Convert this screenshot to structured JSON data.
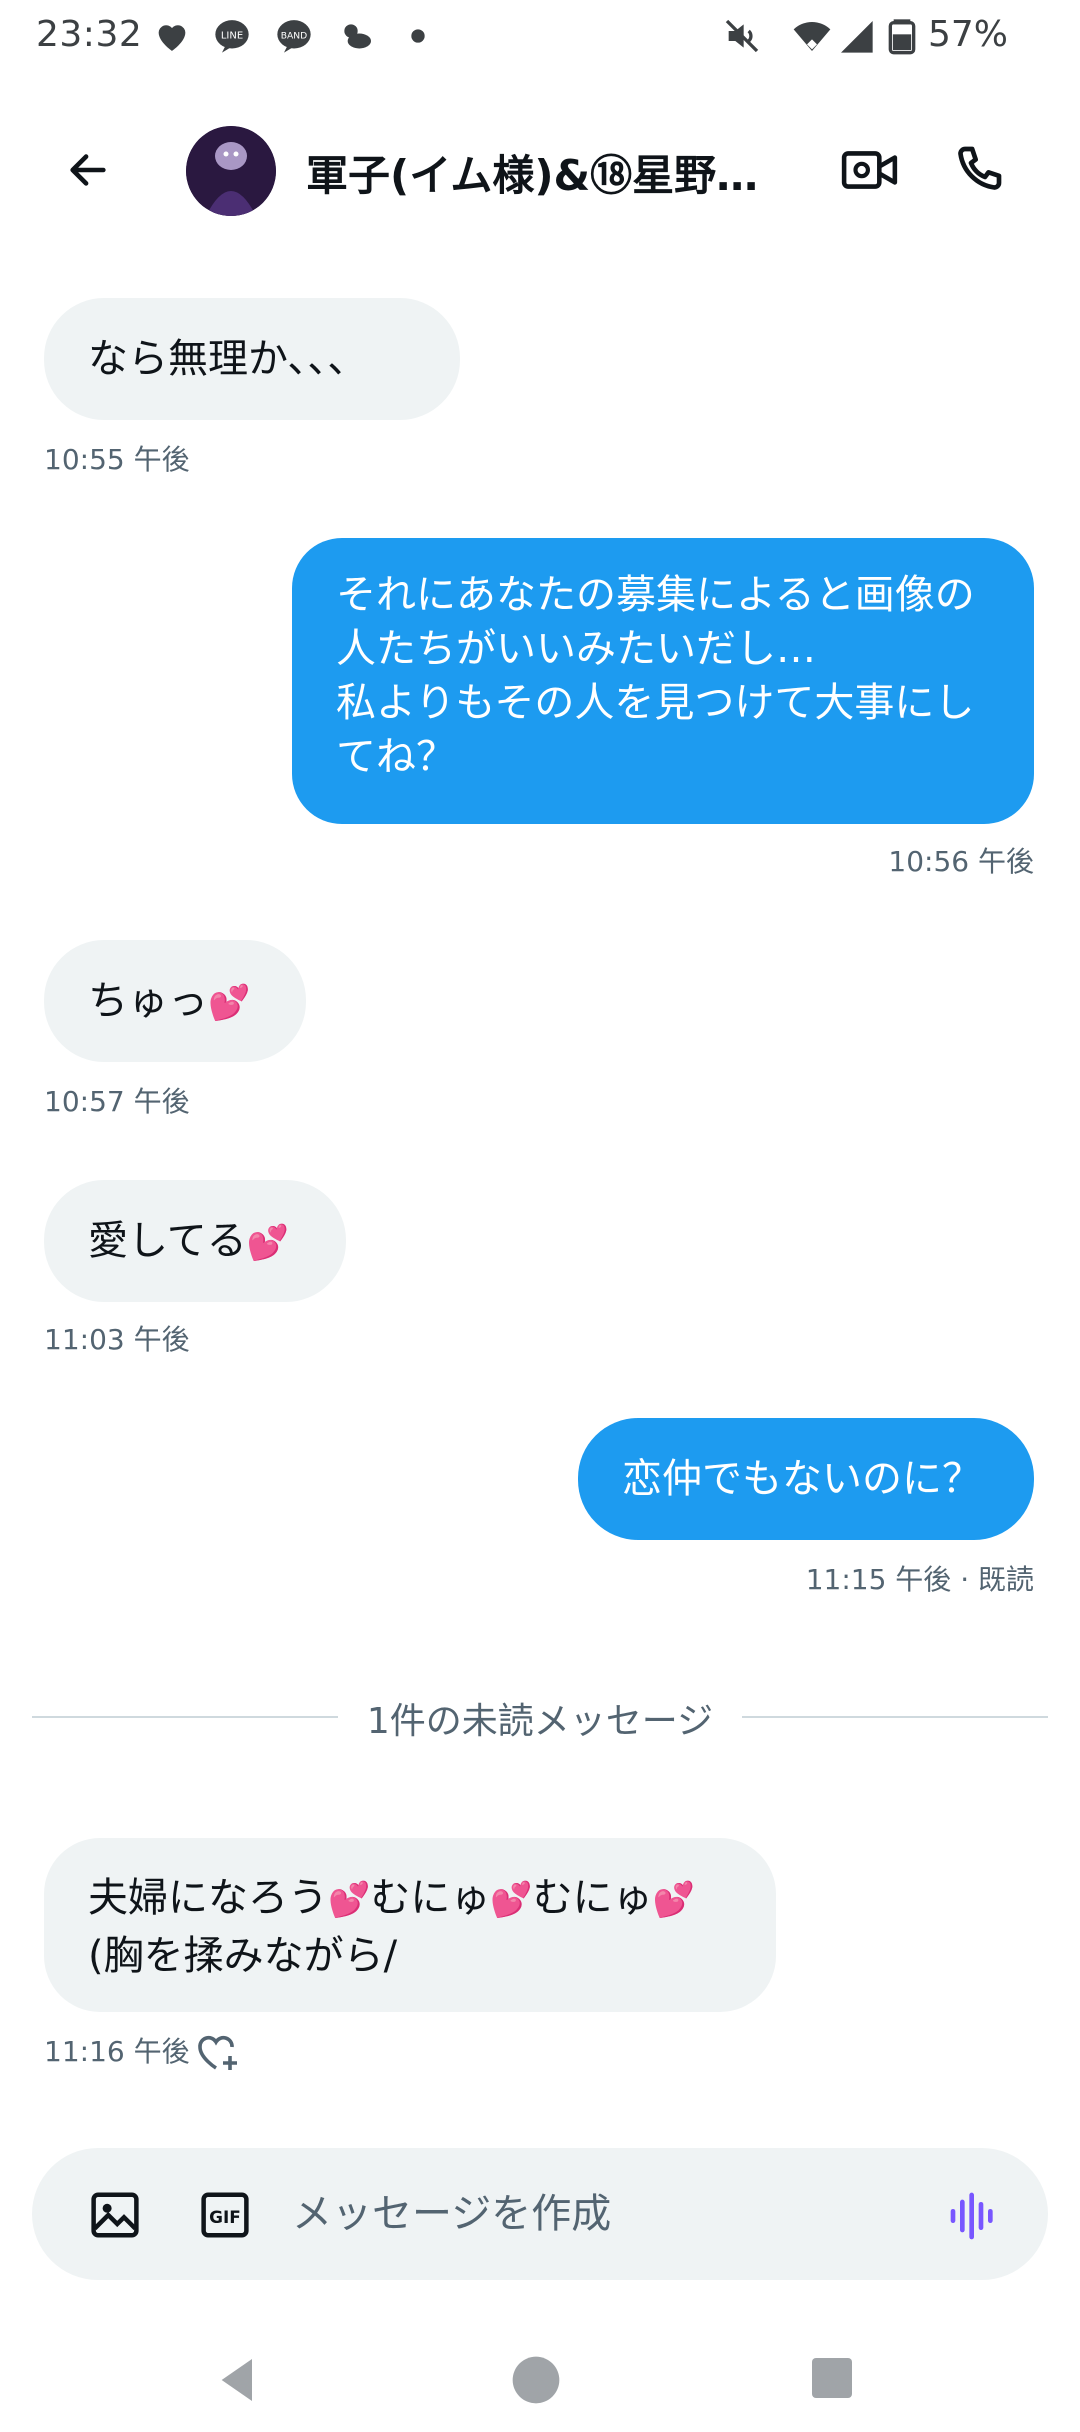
{
  "status_bar": {
    "time": "23:32",
    "battery_percent": "57%",
    "left_icons": [
      "heart-icon",
      "line-app-icon",
      "band-app-icon",
      "weather-icon",
      "dot-icon"
    ],
    "right_icons": [
      "mute-icon",
      "wifi-icon",
      "signal-icon",
      "battery-icon"
    ]
  },
  "header": {
    "conversation_name": "軍子(イム様)&⑱星野…"
  },
  "messages": [
    {
      "direction": "in",
      "text": "なら無理か、、、",
      "time": "10:55 午後"
    },
    {
      "direction": "out",
      "lines": [
        "それにあなたの募集によると画像の",
        "人たちがいいみたいだし…",
        "私よりもその人を見つけて大事にし",
        "てね？"
      ],
      "time": "10:56 午後"
    },
    {
      "direction": "in",
      "text": "ちゅっ",
      "time": "10:57 午後"
    },
    {
      "direction": "in",
      "text": "愛してる",
      "time": "11:03 午後"
    },
    {
      "direction": "out",
      "text": "恋仲でもないのに？",
      "time": "11:15 午後 · 既読"
    },
    {
      "direction": "in",
      "lines": [
        "夫婦になろう",
        "むにゅ",
        "むにゅ",
        "(胸を揉みながら/"
      ],
      "time": "11:16 午後"
    }
  ],
  "unread_divider": "1件の未読メッセージ",
  "composer": {
    "placeholder": "メッセージを作成"
  },
  "colors": {
    "outgoing_bubble": "#1d9bf0",
    "incoming_bubble": "#eff3f4",
    "heart": "#e8101f",
    "voice_accent": "#7856ff"
  }
}
